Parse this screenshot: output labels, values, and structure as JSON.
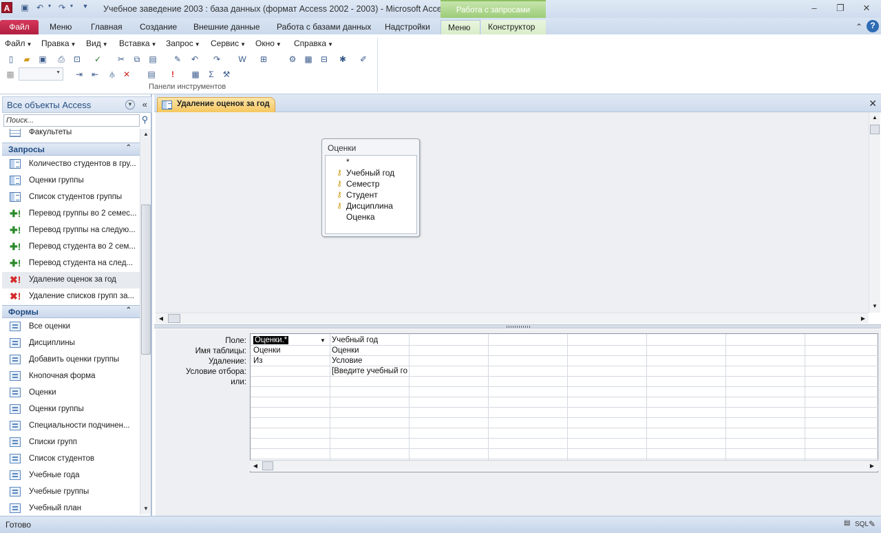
{
  "window": {
    "title": "Учебное заведение 2003 : база данных (формат Access 2002 - 2003)  -  Microsoft Access",
    "context_group": "Работа с запросами",
    "app_letter": "A"
  },
  "ribbon_tabs": [
    {
      "label": "Файл"
    },
    {
      "label": "Меню"
    },
    {
      "label": "Главная"
    },
    {
      "label": "Создание"
    },
    {
      "label": "Внешние данные"
    },
    {
      "label": "Работа с базами данных"
    },
    {
      "label": "Надстройки"
    },
    {
      "label": "Меню"
    },
    {
      "label": "Конструктор"
    }
  ],
  "menubar": [
    "Файл",
    "Правка",
    "Вид",
    "Вставка",
    "Запрос",
    "Сервис",
    "Окно",
    "Справка"
  ],
  "ribbon_group_label": "Панели инструментов",
  "nav": {
    "header": "Все объекты Access",
    "search_placeholder": "Поиск...",
    "partial_item": "Факультеты",
    "groups": [
      {
        "label": "Запросы",
        "items": [
          {
            "label": "Количество студентов в гру...",
            "icon": "select-query-icon"
          },
          {
            "label": "Оценки группы",
            "icon": "select-query-icon"
          },
          {
            "label": "Список студентов группы",
            "icon": "select-query-icon"
          },
          {
            "label": "Перевод группы во 2 семес...",
            "icon": "append-query-icon"
          },
          {
            "label": "Перевод группы на следую...",
            "icon": "append-query-icon"
          },
          {
            "label": "Перевод студента во 2 сем...",
            "icon": "append-query-icon"
          },
          {
            "label": "Перевод студента на след...",
            "icon": "append-query-icon"
          },
          {
            "label": "Удаление оценок за год",
            "icon": "delete-query-icon",
            "selected": true
          },
          {
            "label": "Удаление списков групп за...",
            "icon": "delete-query-icon"
          }
        ]
      },
      {
        "label": "Формы",
        "items": [
          {
            "label": "Все оценки"
          },
          {
            "label": "Дисциплины"
          },
          {
            "label": "Добавить оценки группы"
          },
          {
            "label": "Кнопочная форма"
          },
          {
            "label": "Оценки"
          },
          {
            "label": "Оценки группы"
          },
          {
            "label": "Специальности подчинен..."
          },
          {
            "label": "Списки групп"
          },
          {
            "label": "Список студентов"
          },
          {
            "label": "Учебные года"
          },
          {
            "label": "Учебные группы"
          },
          {
            "label": "Учебный план"
          }
        ]
      }
    ]
  },
  "document": {
    "tab_label": "Удаление оценок за год",
    "field_list": {
      "title": "Оценки",
      "fields": [
        {
          "name": "*",
          "key": false
        },
        {
          "name": "Учебный год",
          "key": true
        },
        {
          "name": "Семестр",
          "key": true
        },
        {
          "name": "Студент",
          "key": true
        },
        {
          "name": "Дисциплина",
          "key": true
        },
        {
          "name": "Оценка",
          "key": false
        }
      ]
    },
    "grid": {
      "row_labels": [
        "Поле:",
        "Имя таблицы:",
        "Удаление:",
        "Условие отбора:",
        "или:"
      ],
      "columns": [
        {
          "field": "Оценки.*",
          "table": "Оценки",
          "delete": "Из",
          "criteria": ""
        },
        {
          "field": "Учебный год",
          "table": "Оценки",
          "delete": "Условие",
          "criteria": "[Введите учебный го"
        }
      ]
    }
  },
  "status": {
    "text": "Готово",
    "view_label": "SQL"
  }
}
